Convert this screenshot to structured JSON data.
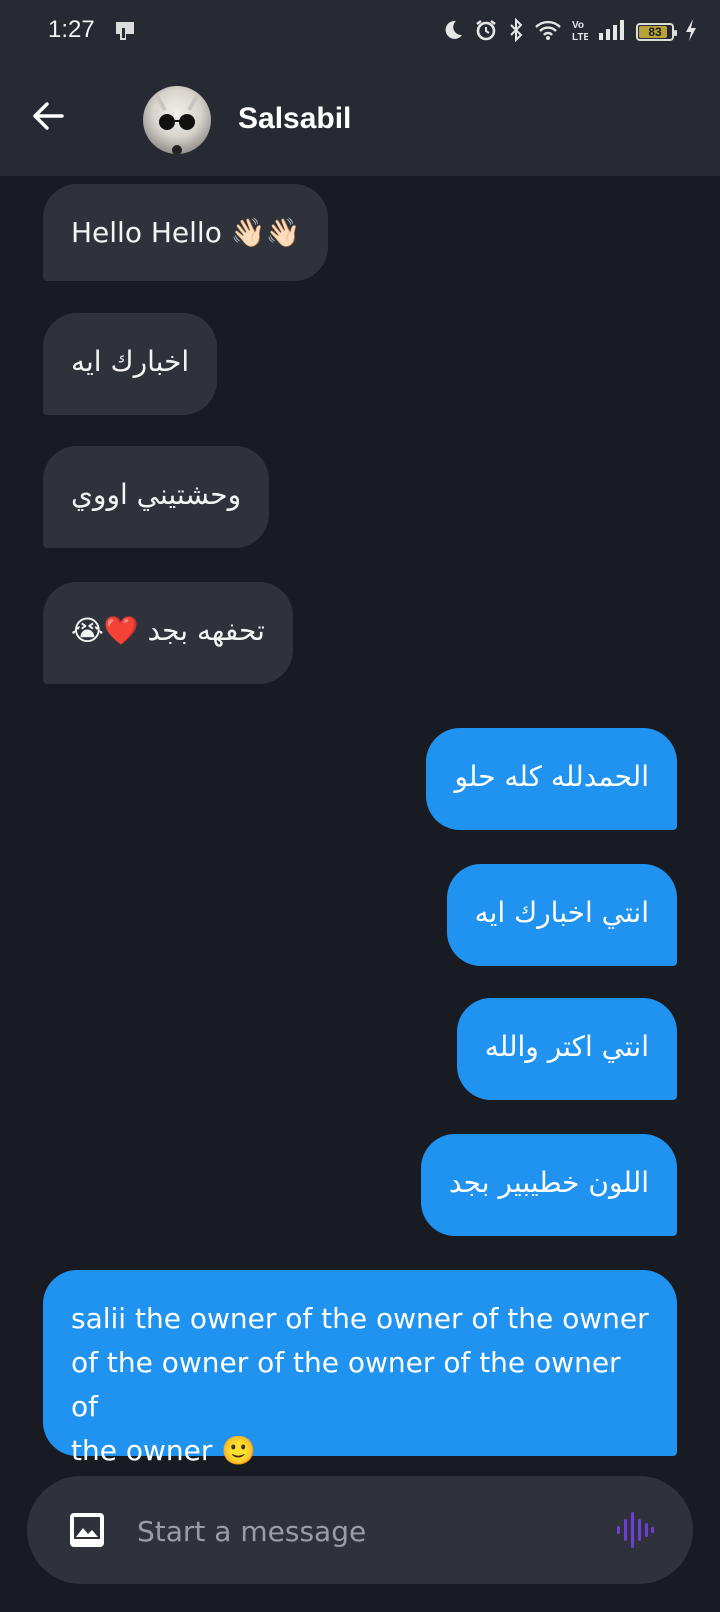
{
  "status_bar": {
    "time": "1:27",
    "icons": [
      "moon-icon",
      "alarm-icon",
      "bluetooth-icon",
      "wifi-icon",
      "volte-icon",
      "signal-icon"
    ],
    "battery": "83",
    "battery_color": "#b8a23a"
  },
  "header": {
    "contact_name": "Salsabil",
    "back_icon": "arrow-left-icon"
  },
  "messages": [
    {
      "dir": "in",
      "text": "Hello Hello 👋🏻👋🏻"
    },
    {
      "dir": "in",
      "text": "اخبارك ايه"
    },
    {
      "dir": "in",
      "text": "وحشتيني اووي"
    },
    {
      "dir": "in",
      "text": "تحفهه بجد ❤️😭"
    },
    {
      "dir": "out",
      "text": "الحمدلله كله حلو"
    },
    {
      "dir": "out",
      "text": "انتي اخبارك ايه"
    },
    {
      "dir": "out",
      "text": "انتي اكتر والله"
    },
    {
      "dir": "out",
      "text": "اللون خطيبير بجد"
    },
    {
      "dir": "out",
      "text": "salii the owner of the owner of the owner\nof the owner of the owner of the owner of\nthe owner 🙂"
    }
  ],
  "composer": {
    "placeholder": "Start a message",
    "image_icon": "image-icon",
    "voice_icon": "voice-waveform-icon"
  },
  "colors": {
    "background": "#191b22",
    "header": "#272933",
    "incoming_bubble": "#30323b",
    "outgoing_bubble": "#1f93ef",
    "accent_voice": "#6e3fd6"
  }
}
